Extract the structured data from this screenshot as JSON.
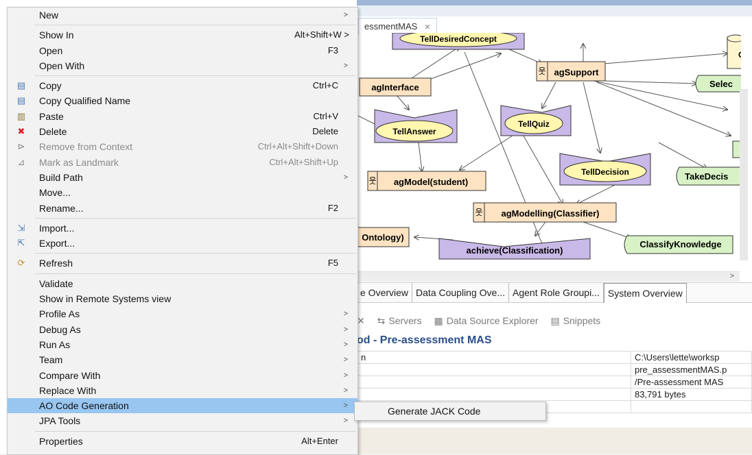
{
  "editor": {
    "tab_title": "essmentMAS",
    "diagram": {
      "agents": [
        "agSupport",
        "agModel(student)",
        "agModelling(Classifier)"
      ],
      "entities": [
        "agInterface",
        "Ontology)"
      ],
      "messages": [
        "TellDesiredConcept",
        "TellAnswer",
        "TellQuiz",
        "TellDecision"
      ],
      "goals": [
        "achieve(Classification)"
      ],
      "actions": [
        "Selec",
        "TakeDecis",
        "ClassifyKnowledge"
      ],
      "db_letter": "C"
    },
    "overview_tabs": [
      "e Overview",
      "Data Coupling Ove...",
      "Agent Role Groupi...",
      "System Overview"
    ],
    "views": [
      {
        "icon": "servers-icon",
        "label": "Servers"
      },
      {
        "icon": "data-source-icon",
        "label": "Data Source Explorer"
      },
      {
        "icon": "snippets-icon",
        "label": "Snippets"
      }
    ],
    "properties_title": "od - Pre-assessment MAS",
    "properties_rows": [
      {
        "key": "n",
        "value": "C:\\Users\\lette\\worksp"
      },
      {
        "key": "",
        "value": "pre_assessmentMAS.p"
      },
      {
        "key": "",
        "value": "/Pre-assessment MAS"
      },
      {
        "key": "",
        "value": "83,791  bytes"
      },
      {
        "key": "",
        "value": ""
      }
    ]
  },
  "context_menu": {
    "items": [
      {
        "label": "New",
        "submenu": true
      },
      {
        "separator": true
      },
      {
        "label": "Show In",
        "shortcut": "Alt+Shift+W >"
      },
      {
        "label": "Open",
        "shortcut": "F3"
      },
      {
        "label": "Open With",
        "submenu": true
      },
      {
        "separator": true
      },
      {
        "label": "Copy",
        "shortcut": "Ctrl+C",
        "icon": "copy-icon"
      },
      {
        "label": "Copy Qualified Name",
        "icon": "copy-qualified-icon"
      },
      {
        "label": "Paste",
        "shortcut": "Ctrl+V",
        "icon": "paste-icon"
      },
      {
        "label": "Delete",
        "shortcut": "Delete",
        "icon": "delete-icon"
      },
      {
        "label": "Remove from Context",
        "shortcut": "Ctrl+Alt+Shift+Down",
        "disabled": true,
        "icon": "remove-context-icon"
      },
      {
        "label": "Mark as Landmark",
        "shortcut": "Ctrl+Alt+Shift+Up",
        "disabled": true,
        "icon": "landmark-icon"
      },
      {
        "label": "Build Path",
        "submenu": true
      },
      {
        "label": "Move..."
      },
      {
        "label": "Rename...",
        "shortcut": "F2"
      },
      {
        "separator": true
      },
      {
        "label": "Import...",
        "icon": "import-icon"
      },
      {
        "label": "Export...",
        "icon": "export-icon"
      },
      {
        "separator": true
      },
      {
        "label": "Refresh",
        "shortcut": "F5",
        "icon": "refresh-icon"
      },
      {
        "separator": true
      },
      {
        "label": "Validate"
      },
      {
        "label": "Show in Remote Systems view"
      },
      {
        "label": "Profile As",
        "submenu": true
      },
      {
        "label": "Debug As",
        "submenu": true
      },
      {
        "label": "Run As",
        "submenu": true
      },
      {
        "label": "Team",
        "submenu": true
      },
      {
        "label": "Compare With",
        "submenu": true
      },
      {
        "label": "Replace With",
        "submenu": true
      },
      {
        "label": "AO Code Generation",
        "submenu": true,
        "highlighted": true
      },
      {
        "label": "JPA Tools",
        "submenu": true
      },
      {
        "separator": true
      },
      {
        "label": "Properties",
        "shortcut": "Alt+Enter"
      }
    ]
  },
  "submenu": {
    "label": "Generate JACK Code"
  },
  "colors": {
    "menu_bg": "#f2f2f2",
    "menu_highlight": "#98c6f0",
    "agent_fill": "#fde3c2",
    "message_fill": "#c9b9e8",
    "message_oval": "#fff6b0",
    "action_fill": "#d8f2c6",
    "title_blue": "#2a4e8a"
  }
}
